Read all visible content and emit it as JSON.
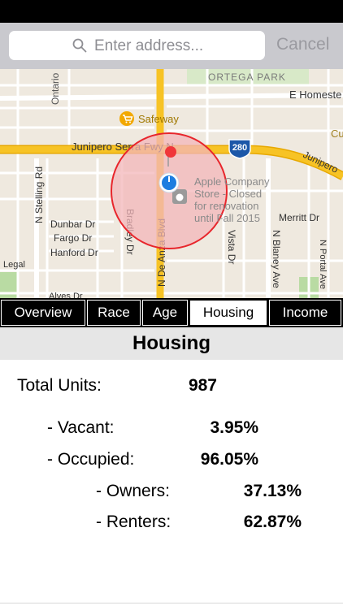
{
  "search": {
    "placeholder": "Enter address...",
    "cancel_label": "Cancel"
  },
  "map": {
    "labels": {
      "ortega_park": "ORTEGA PARK",
      "e_homestead": "E Homeste",
      "safeway": "Safeway",
      "junipero_serra": "Junipero Serra Fwy N",
      "junipero_right": "Junipero",
      "shield_280": "280",
      "apple_store_1": "Apple Company",
      "apple_store_2": "Store - Closed",
      "apple_store_3": "for renovation",
      "apple_store_4": "until Fall 2015",
      "n_stelling": "N Stelling Rd",
      "dunbar": "Dunbar Dr",
      "fargo": "Fargo Dr",
      "hanford": "Hanford Dr",
      "bradley": "Bradley Dr",
      "n_de_anza": "N De Anza Blvd",
      "vista": "Vista Dr",
      "merritt": "Merritt Dr",
      "n_blaney": "N Blaney Ave",
      "n_portal": "N Portal Ave",
      "ontario": "Ontario",
      "legal": "Legal",
      "alves": "Alves Dr",
      "cu": "Cu"
    }
  },
  "tabs": [
    {
      "label": "Overview"
    },
    {
      "label": "Race"
    },
    {
      "label": "Age"
    },
    {
      "label": "Housing"
    },
    {
      "label": "Income"
    }
  ],
  "active_tab": "Housing",
  "housing": {
    "title": "Housing",
    "total_units_label": "Total Units:",
    "total_units_value": "987",
    "vacant_label": "- Vacant:",
    "vacant_value": "3.95%",
    "occupied_label": "- Occupied:",
    "occupied_value": "96.05%",
    "owners_label": "- Owners:",
    "owners_value": "37.13%",
    "renters_label": "- Renters:",
    "renters_value": "62.87%"
  },
  "colors": {
    "search_bar_bg": "#c9c9ce",
    "map_bg": "#efe9df",
    "highway": "#f7c325",
    "radius_fill": "#f3b5b9",
    "radius_stroke": "#e8262c",
    "location_blue": "#1e7de0",
    "pin_red": "#f0363a"
  },
  "icons": {
    "search": "search-icon",
    "safeway": "shopping-cart-icon",
    "apple": "apple-store-icon"
  }
}
